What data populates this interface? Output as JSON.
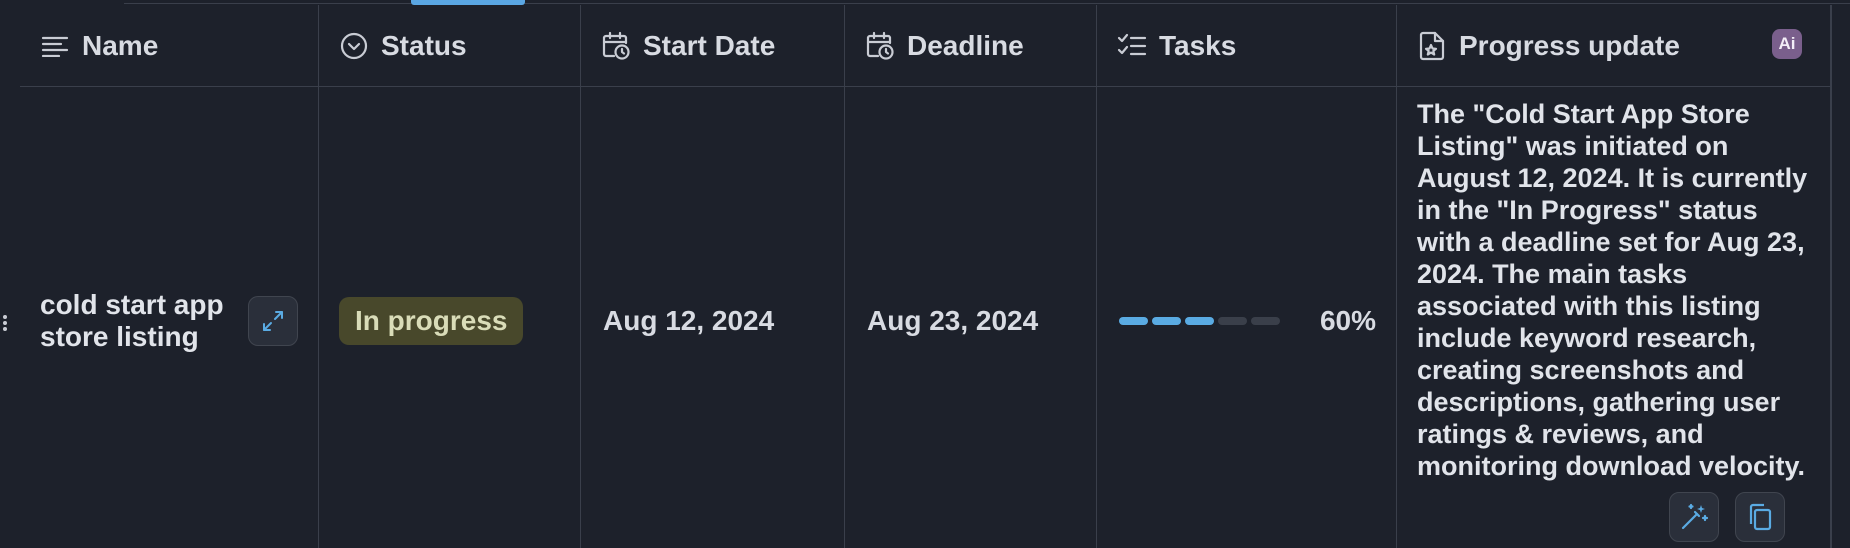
{
  "columns": {
    "name": {
      "label": "Name",
      "icon": "text-align-left-icon"
    },
    "status": {
      "label": "Status",
      "icon": "chevron-circle-icon"
    },
    "start_date": {
      "label": "Start Date",
      "icon": "calendar-clock-icon"
    },
    "deadline": {
      "label": "Deadline",
      "icon": "calendar-clock-icon"
    },
    "tasks": {
      "label": "Tasks",
      "icon": "checklist-icon"
    },
    "progress_update": {
      "label": "Progress update",
      "icon": "document-star-icon",
      "badge": "Ai"
    }
  },
  "row": {
    "name": "cold start app store listing",
    "status": "In progress",
    "start_date": "Aug 12, 2024",
    "deadline": "Aug 23, 2024",
    "tasks_progress": 0.6,
    "tasks_percent_label": "60%",
    "tasks_segments_total": 5,
    "tasks_segments_done": 3,
    "progress_update": "The \"Cold Start App Store Listing\" was initiated on August 12, 2024. It is currently in the \"In Progress\" status with a deadline set for Aug 23, 2024. The main tasks associated with this listing include keyword research, creating screenshots and descriptions, gathering user ratings & reviews, and monitoring download velocity."
  },
  "icons": {
    "row_handle": "drag-handle-icon",
    "expand": "expand-arrows-icon",
    "magic": "magic-wand-icon",
    "copy": "copy-icon"
  },
  "colors": {
    "background": "#1d212b",
    "accent": "#5aabe3",
    "status_pill_bg": "#48482b",
    "ai_badge": "#7a5f8c"
  }
}
